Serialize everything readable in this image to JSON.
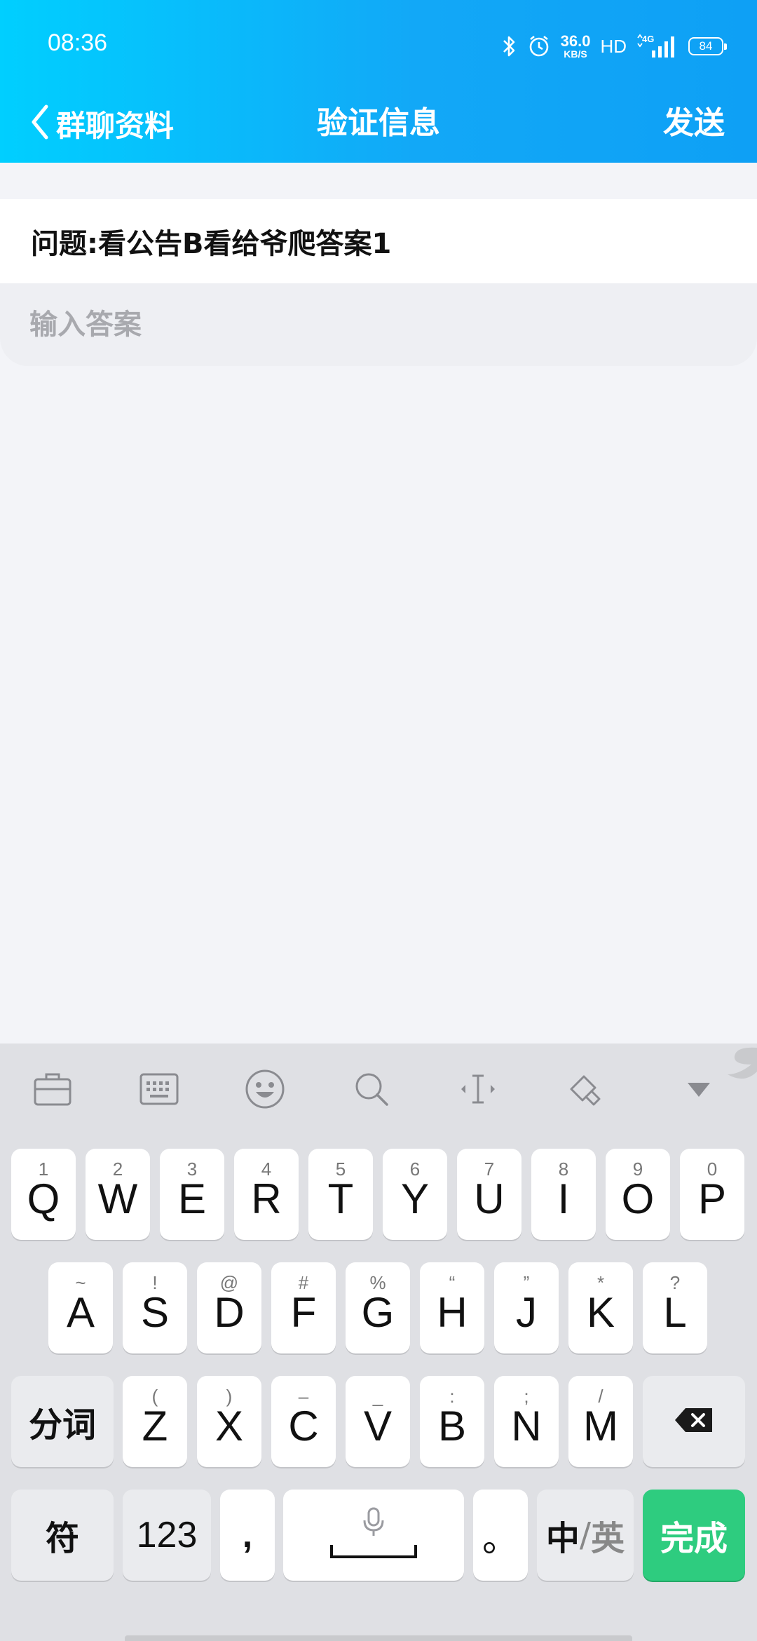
{
  "status_bar": {
    "time": "08:36",
    "speed_value": "36.0",
    "speed_unit": "KB/S",
    "hd": "HD",
    "network": "4G",
    "battery": "84"
  },
  "nav": {
    "back_label": "群聊资料",
    "title": "验证信息",
    "send_label": "发送"
  },
  "content": {
    "question": "问题:看公告B看给爷爬答案1",
    "answer_value": "",
    "answer_placeholder": "输入答案"
  },
  "keyboard": {
    "toolbar_icons": [
      "toolbox-icon",
      "keyboard-icon",
      "emoji-icon",
      "search-icon",
      "cursor-icon",
      "clipboard-icon",
      "hide-keyboard-icon"
    ],
    "row1": [
      {
        "key": "Q",
        "hint": "1"
      },
      {
        "key": "W",
        "hint": "2"
      },
      {
        "key": "E",
        "hint": "3"
      },
      {
        "key": "R",
        "hint": "4"
      },
      {
        "key": "T",
        "hint": "5"
      },
      {
        "key": "Y",
        "hint": "6"
      },
      {
        "key": "U",
        "hint": "7"
      },
      {
        "key": "I",
        "hint": "8"
      },
      {
        "key": "O",
        "hint": "9"
      },
      {
        "key": "P",
        "hint": "0"
      }
    ],
    "row2": [
      {
        "key": "A",
        "hint": "~"
      },
      {
        "key": "S",
        "hint": "!"
      },
      {
        "key": "D",
        "hint": "@"
      },
      {
        "key": "F",
        "hint": "#"
      },
      {
        "key": "G",
        "hint": "%"
      },
      {
        "key": "H",
        "hint": "“"
      },
      {
        "key": "J",
        "hint": "”"
      },
      {
        "key": "K",
        "hint": "*"
      },
      {
        "key": "L",
        "hint": "?"
      }
    ],
    "row3": [
      {
        "key": "Z",
        "hint": "("
      },
      {
        "key": "X",
        "hint": ")"
      },
      {
        "key": "C",
        "hint": "–"
      },
      {
        "key": "V",
        "hint": "_"
      },
      {
        "key": "B",
        "hint": ":"
      },
      {
        "key": "N",
        "hint": ";"
      },
      {
        "key": "M",
        "hint": "/"
      }
    ],
    "segment_label": "分词",
    "symbol_label": "符",
    "num_label": "123",
    "comma": ",",
    "period": "。",
    "lang_cn": "中",
    "lang_sep": "/",
    "lang_en": "英",
    "done_label": "完成",
    "accent_color": "#2ecc7f"
  },
  "colors": {
    "header_start": "#00cfff",
    "header_end": "#0ea0f5",
    "background": "#f3f4f8"
  }
}
